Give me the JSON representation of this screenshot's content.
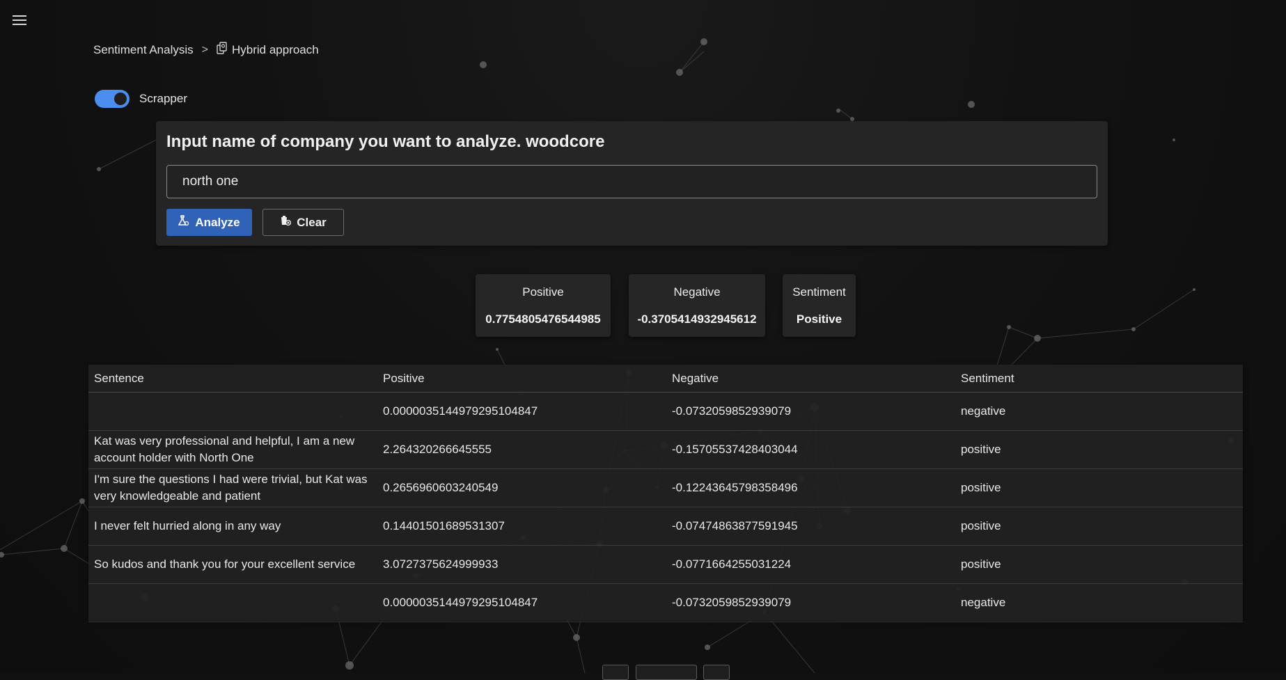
{
  "breadcrumb": {
    "root": "Sentiment Analysis",
    "separator": ">",
    "current": "Hybrid approach",
    "current_icon": "document-scan-icon"
  },
  "toggle": {
    "label": "Scrapper",
    "on": true
  },
  "form": {
    "title": "Input name of company you want to analyze. woodcore",
    "input_value": "north one",
    "analyze_label": "Analyze",
    "clear_label": "Clear"
  },
  "summary": {
    "positive_label": "Positive",
    "positive_value": "0.7754805476544985",
    "negative_label": "Negative",
    "negative_value": "-0.3705414932945612",
    "sentiment_label": "Sentiment",
    "sentiment_value": "Positive"
  },
  "table": {
    "headers": [
      "Sentence",
      "Positive",
      "Negative",
      "Sentiment"
    ],
    "rows": [
      {
        "sentence": "",
        "positive": "0.0000035144979295104847",
        "negative": "-0.0732059852939079",
        "sentiment": "negative"
      },
      {
        "sentence": "Kat was very professional and helpful, I am a new account holder with North One",
        "positive": "2.264320266645555",
        "negative": "-0.15705537428403044",
        "sentiment": "positive"
      },
      {
        "sentence": "I'm sure the questions I had were trivial, but Kat was very knowledgeable and patient",
        "positive": "0.2656960603240549",
        "negative": "-0.12243645798358496",
        "sentiment": "positive"
      },
      {
        "sentence": "I never felt hurried along in any way",
        "positive": "0.14401501689531307",
        "negative": "-0.07474863877591945",
        "sentiment": "positive"
      },
      {
        "sentence": "So kudos and thank you for your excellent service",
        "positive": "3.0727375624999933",
        "negative": "-0.0771664255031224",
        "sentiment": "positive"
      },
      {
        "sentence": "",
        "positive": "0.0000035144979295104847",
        "negative": "-0.0732059852939079",
        "sentiment": "negative"
      }
    ]
  },
  "colors": {
    "accent": "#3062b8",
    "toggle": "#4b8ef0",
    "background": "#111111",
    "card": "#252525"
  }
}
